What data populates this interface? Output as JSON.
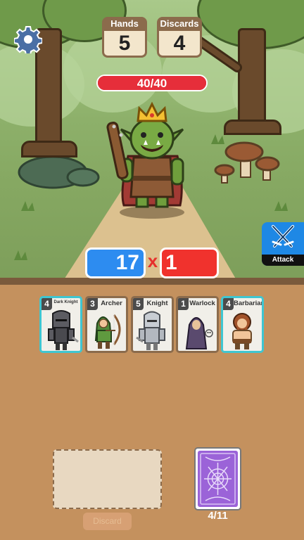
{
  "top_bar": {
    "hands_label": "Hands",
    "hands_value": "5",
    "discards_label": "Discards",
    "discards_value": "4"
  },
  "enemy": {
    "hp_text": "40/40",
    "hp_fraction": 1.0
  },
  "score": {
    "chips": "17",
    "times": "x",
    "mult": "1"
  },
  "attack_button": {
    "label": "Attack"
  },
  "hand": [
    {
      "value": "4",
      "name": "Dark Knight",
      "selected": true
    },
    {
      "value": "3",
      "name": "Archer",
      "selected": false
    },
    {
      "value": "5",
      "name": "Knight",
      "selected": false
    },
    {
      "value": "1",
      "name": "Warlock",
      "selected": false
    },
    {
      "value": "4",
      "name": "Barbarian",
      "selected": true
    }
  ],
  "discard_button": {
    "label": "Discard"
  },
  "deck": {
    "count": "4/11"
  },
  "colors": {
    "chips": "#2d8cf0",
    "mult": "#f0322d",
    "hp": "#e62e3a",
    "selected_card_border": "#3fc6d1",
    "card_border": "#8b6b4c",
    "panel": "#c4915e"
  }
}
